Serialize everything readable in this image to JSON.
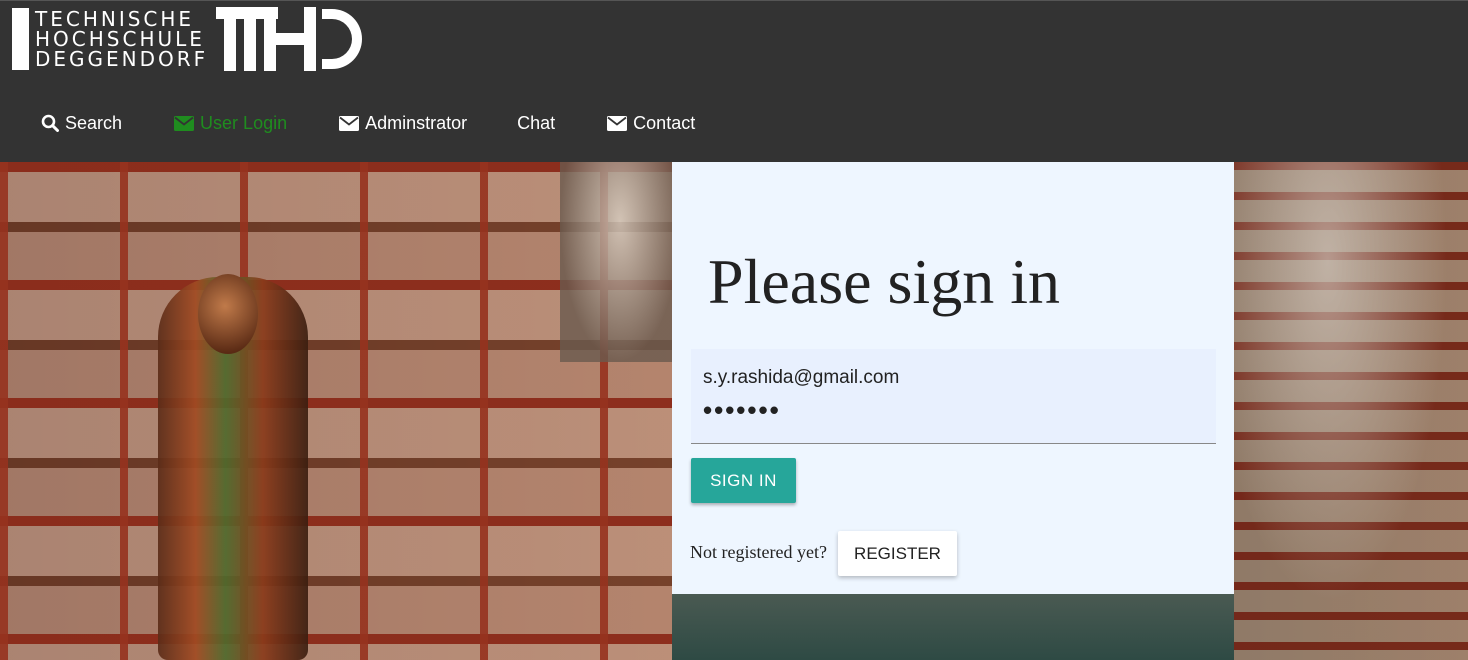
{
  "logo": {
    "line1": "TECHNISCHE",
    "line2": "HOCHSCHULE",
    "line3": "DEGGENDORF",
    "mark": "THD"
  },
  "nav": {
    "search": {
      "label": "Search",
      "icon": "search-icon"
    },
    "user_login": {
      "label": "User Login",
      "icon": "envelope-icon",
      "active": true,
      "color": "#1f8c1f"
    },
    "administrator": {
      "label": "Adminstrator",
      "icon": "envelope-icon"
    },
    "chat": {
      "label": "Chat"
    },
    "contact": {
      "label": "Contact",
      "icon": "envelope-icon"
    }
  },
  "login": {
    "title": "Please sign in",
    "email_value": "s.y.rashida@gmail.com",
    "password_value": "•••••••",
    "signin_label": "SIGN IN",
    "not_registered_text": "Not registered yet?",
    "register_label": "REGISTER"
  },
  "colors": {
    "topbar": "#333333",
    "panel": "#eef6ff",
    "accent": "#26a69a",
    "active_nav": "#1f8c1f"
  }
}
